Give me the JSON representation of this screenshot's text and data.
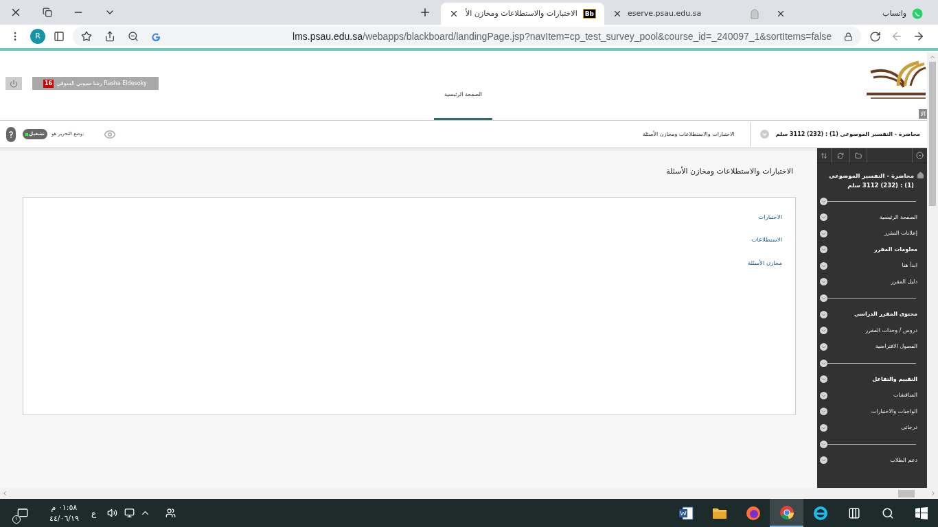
{
  "browser": {
    "tabs": [
      {
        "title": "واتساب",
        "selected": false
      },
      {
        "title": "eserve.psau.edu.sa",
        "selected": false
      },
      {
        "title": "الاختبارات والاستطلاعات ومخازن الأ",
        "favicon": "Bb",
        "selected": true
      }
    ],
    "profile_initial": "R",
    "url_domain": "lms.psau.edu.sa",
    "url_path": "/webapps/blackboard/landingPage.jsp?navItem=cp_test_survey_pool&course_id=_240097_1&sortItems=false"
  },
  "header": {
    "user_name": "رشا سيوني السوقي Rasha Eldesoky",
    "notification_count": "16",
    "nav_tab": {
      "label": "الصفحة الرئيسية",
      "selected": true
    },
    "side_tab": "الا"
  },
  "breadcrumb": {
    "course": "محاضرة - التفسير الموضوعي (1) : (232) 3112 سلم",
    "page": "الاختبارات والاستطلاعات ومخازن الأسئلة",
    "edit_mode_label": "وضع التحرير هو:",
    "edit_mode_value": "تشغيل",
    "edit_mode_on": true
  },
  "content": {
    "title": "الاختبارات والاستطلاعات ومخازن الأسئلة",
    "links": [
      "الاختبارات",
      "الاستطلاعات",
      "مخازن الأسئلة"
    ]
  },
  "sidebar": {
    "course_title": "محاضرة - التفسير الموضوعي (1) : (232) 3112 سلم",
    "groups": [
      {
        "items": [
          {
            "label": "الصفحة الرئيسية",
            "kind": "link"
          },
          {
            "label": "إعلانات المقرر",
            "kind": "link"
          },
          {
            "label": "معلومات المقرر",
            "kind": "heading"
          },
          {
            "label": "ابدأ هنا",
            "kind": "link"
          },
          {
            "label": "دليل المقرر",
            "kind": "link"
          }
        ]
      },
      {
        "items": [
          {
            "label": "محتوى المقرر الدراسي",
            "kind": "heading"
          },
          {
            "label": "دروس / وحدات المقرر",
            "kind": "link"
          },
          {
            "label": "الفصول الافتراضية",
            "kind": "link"
          }
        ]
      },
      {
        "items": [
          {
            "label": "التقييم والتفاعل",
            "kind": "heading"
          },
          {
            "label": "المناقشات",
            "kind": "link"
          },
          {
            "label": "الواجبات والاختبارات",
            "kind": "link"
          },
          {
            "label": "درجاتي",
            "kind": "link"
          }
        ]
      },
      {
        "items": [
          {
            "label": "دعم الطلاب",
            "kind": "link"
          }
        ]
      }
    ]
  },
  "taskbar": {
    "time": "٠١:٥٨ م",
    "date": "٤٤/٠٦/١٩",
    "language": "ع",
    "notification_count": "١",
    "apps": [
      {
        "kind": "word",
        "selected": false
      },
      {
        "kind": "explorer",
        "selected": false
      },
      {
        "kind": "firefox",
        "selected": false
      },
      {
        "kind": "chrome",
        "selected": true
      },
      {
        "kind": "ie",
        "selected": false
      },
      {
        "kind": "taskview",
        "selected": false
      },
      {
        "kind": "search",
        "selected": false
      },
      {
        "kind": "start",
        "selected": false
      }
    ]
  }
}
